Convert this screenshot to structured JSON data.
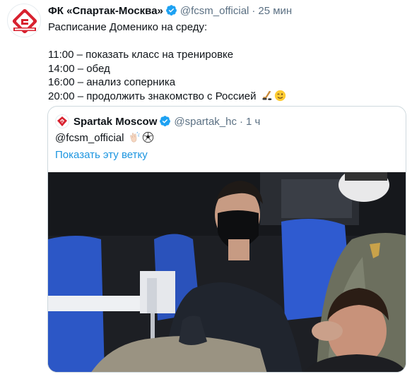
{
  "tweet": {
    "author_name": "ФК «Спартак-Москва»",
    "author_handle": "@fcsm_official",
    "separator": "·",
    "time": "25 мин",
    "lines": [
      "Расписание Доменико на среду:",
      "",
      "11:00 – показать класс на тренировке",
      "14:00 – обед",
      "16:00 – анализ соперника",
      "20:00 – продолжить знакомство с Россией"
    ],
    "line_emojis": [
      "hockey-stick-emoji",
      "winking-face-emoji"
    ]
  },
  "quoted": {
    "author_name": "Spartak Moscow",
    "author_handle": "@spartak_hc",
    "separator": "·",
    "time": "1 ч",
    "text": "@fcsm_official",
    "text_emojis": [
      "clapping-hands-emoji",
      "soccer-ball-emoji"
    ],
    "show_thread_label": "Показать эту ветку"
  },
  "colors": {
    "verified": "#1da1f2",
    "link": "#1b95e0",
    "secondary_text": "#5b7083",
    "spartak_red": "#d8212f",
    "stadium_seat_blue": "#2c57c6"
  }
}
